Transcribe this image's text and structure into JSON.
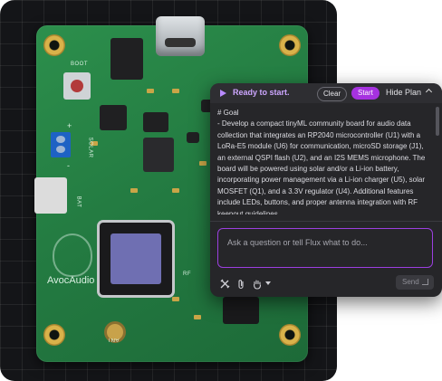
{
  "board": {
    "silk_boot": "BOOT",
    "silk_bat": "BAT",
    "silk_solar": "SOLAR",
    "silk_plus": "+",
    "silk_minus": "-",
    "silk_rf": "RF",
    "silk_ant": "ANT",
    "brand": "AvocAudio"
  },
  "panel": {
    "status": "Ready to start.",
    "clear_label": "Clear",
    "start_label": "Start",
    "hide_plan_label": "Hide Plan",
    "plan_heading": "# Goal",
    "plan_text": "- Develop a compact tinyML community board for audio data collection that integrates an RP2040 microcontroller (U1) with a LoRa-E5 module (U6) for communication, microSD storage (J1), an external QSPI flash (U2), and an I2S MEMS microphone. The board will be powered using solar and/or a Li-ion battery, incorporating power management via a Li-ion charger (U5), solar MOSFET (Q1), and a 3.3V regulator (U4). Additional features include LEDs, buttons, and proper antenna integration with RF keepout guidelines.",
    "input_placeholder": "Ask a question or tell Flux what to do...",
    "send_label": "Send"
  },
  "icons": [
    "play-icon",
    "chevron-up-icon",
    "tools-icon",
    "attachment-icon",
    "hand-icon",
    "chevron-down-icon",
    "enter-icon"
  ],
  "colors": {
    "accent": "#a632e0",
    "status_text": "#cda6ff",
    "panel_bg": "#262629"
  }
}
